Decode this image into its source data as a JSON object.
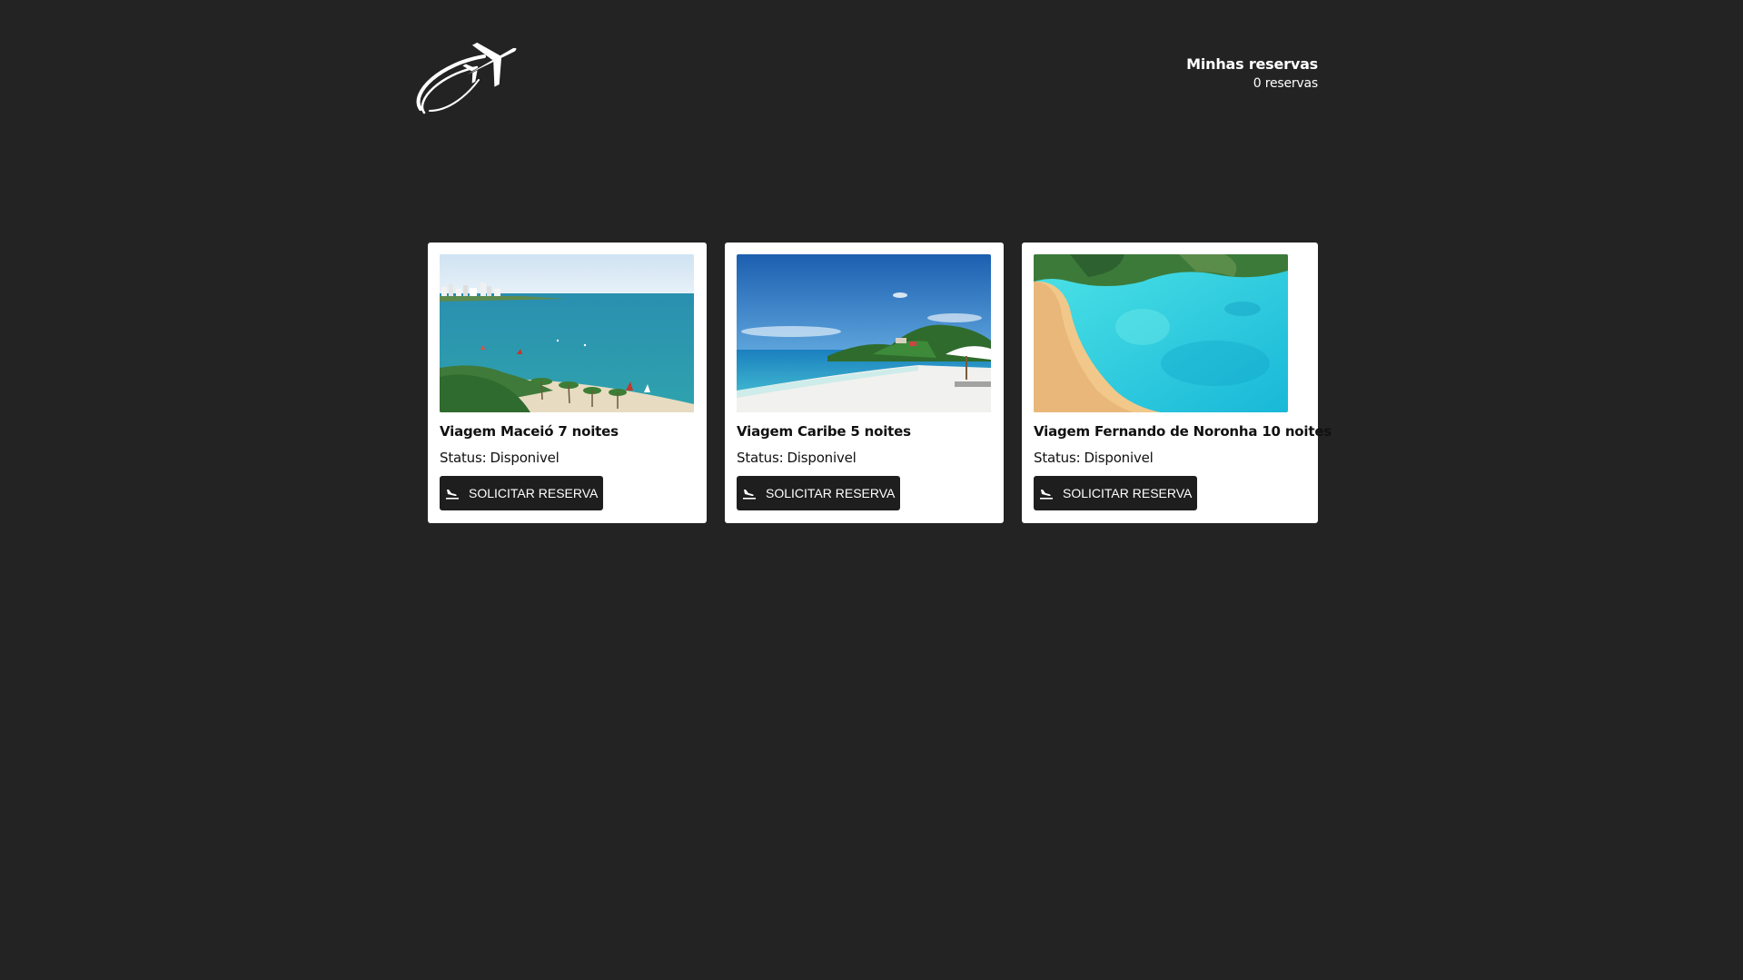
{
  "header": {
    "reservations_title": "Minhas reservas",
    "reservations_count": "0 reservas"
  },
  "trips": [
    {
      "title": "Viagem Maceió 7 noites",
      "status_label": "Status:",
      "status_value": "Disponivel",
      "button_label": "SOLICITAR RESERVA",
      "image": "maceio-beach-photo"
    },
    {
      "title": "Viagem Caribe 5 noites",
      "status_label": "Status:",
      "status_value": "Disponivel",
      "button_label": "SOLICITAR RESERVA",
      "image": "caribbean-beach-photo"
    },
    {
      "title": "Viagem Fernando de Noronha 10 noites",
      "status_label": "Status:",
      "status_value": "Disponivel",
      "button_label": "SOLICITAR RESERVA",
      "image": "noronha-bay-photo"
    }
  ],
  "colors": {
    "background": "#232323",
    "card": "#ffffff",
    "button": "#1e1e1e"
  }
}
